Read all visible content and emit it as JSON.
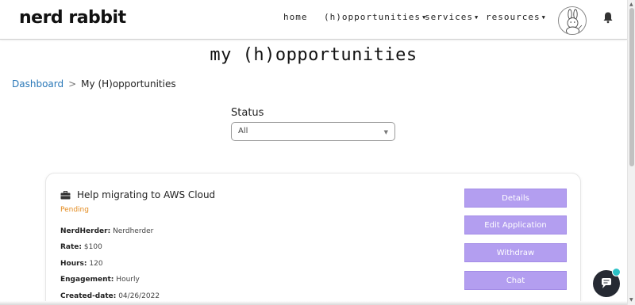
{
  "header": {
    "logo": "nerd rabbit",
    "nav": [
      {
        "label": "home",
        "caret": false
      },
      {
        "label": "(h)opportunities",
        "caret": true
      },
      {
        "label": "services",
        "caret": true
      },
      {
        "label": "resources",
        "caret": true
      }
    ],
    "icons": {
      "avatar": "rabbit-avatar",
      "notifications": "bell-icon"
    }
  },
  "page": {
    "title": "my (h)opportunities"
  },
  "breadcrumb": {
    "link": "Dashboard",
    "separator": ">",
    "current": "My (H)opportunities"
  },
  "filter": {
    "label": "Status",
    "selected": "All"
  },
  "opportunity": {
    "title": "Help migrating to AWS Cloud",
    "status": "Pending",
    "status_color": "#e38a1d",
    "details": [
      {
        "key": "NerdHerder:",
        "value": "Nerdherder"
      },
      {
        "key": "Rate:",
        "value": "$100"
      },
      {
        "key": "Hours:",
        "value": "120"
      },
      {
        "key": "Engagement:",
        "value": "Hourly"
      },
      {
        "key": "Created-date:",
        "value": "04/26/2022"
      }
    ],
    "actions": [
      "Details",
      "Edit Application",
      "Withdraw",
      "Chat"
    ]
  },
  "colors": {
    "accent_button": "#b39ef0",
    "link": "#2a78b8",
    "chat_bubble": "#262a33",
    "notification_dot": "#2cc1c6"
  }
}
